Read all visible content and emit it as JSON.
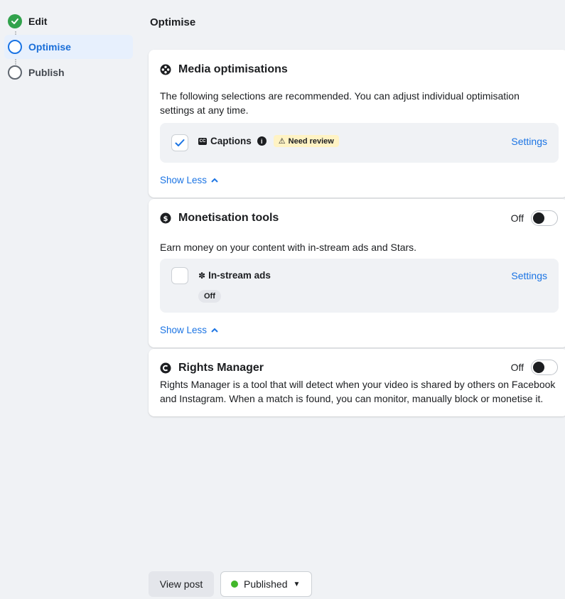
{
  "sidebar": {
    "steps": [
      {
        "label": "Edit",
        "state": "done"
      },
      {
        "label": "Optimise",
        "state": "current"
      },
      {
        "label": "Publish",
        "state": "pending"
      }
    ]
  },
  "main": {
    "title": "Optimise",
    "media": {
      "title": "Media optimisations",
      "icon": "film-reel-icon",
      "description": "The following selections are recommended. You can adjust individual optimisation settings at any time.",
      "option": {
        "label": "Captions",
        "badge": "Need review",
        "checked": true,
        "settings": "Settings"
      },
      "show_less": "Show Less"
    },
    "monetisation": {
      "title": "Monetisation tools",
      "icon": "dollar-icon",
      "toggle_label": "Off",
      "description": "Earn money on your content with in-stream ads and Stars.",
      "option": {
        "label": "In-stream ads",
        "status": "Off",
        "checked": false,
        "settings": "Settings"
      },
      "show_less": "Show Less"
    },
    "rights": {
      "title": "Rights Manager",
      "icon": "copyright-icon",
      "toggle_label": "Off",
      "description": "Rights Manager is a tool that will detect when your video is shared by others on Facebook and Instagram. When a match is found, you can monitor, manually block or monetise it."
    }
  },
  "footer": {
    "view_post": "View post",
    "status": "Published"
  },
  "colors": {
    "accent": "#1b74e4",
    "success": "#31a24c",
    "published": "#42b72a",
    "warning_bg": "#fff3c4"
  }
}
